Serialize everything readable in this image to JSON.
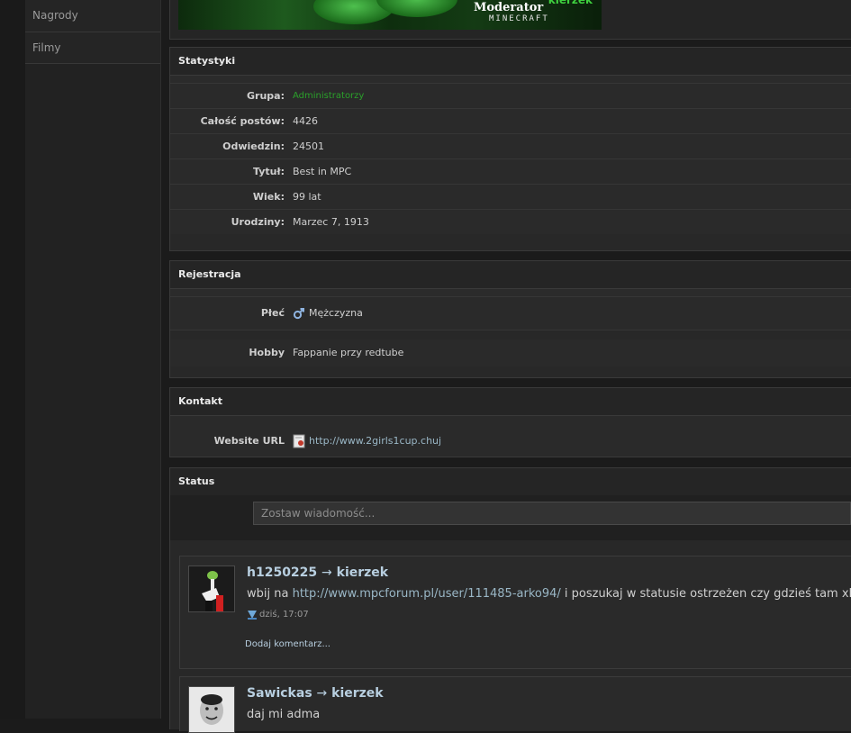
{
  "sidebar": {
    "items": [
      {
        "label": "Nagrody"
      },
      {
        "label": "Filmy"
      }
    ]
  },
  "banner": {
    "brand_text": "kierzek",
    "title": "Moderator",
    "subtitle": "MINECRAFT"
  },
  "statystyki": {
    "title": "Statystyki",
    "rows": [
      {
        "label": "Grupa:",
        "value": "Administratorzy"
      },
      {
        "label": "Całość postów:",
        "value": "4426"
      },
      {
        "label": "Odwiedzin:",
        "value": "24501"
      },
      {
        "label": "Tytuł:",
        "value": "Best in MPC"
      },
      {
        "label": "Wiek:",
        "value": "99 lat"
      },
      {
        "label": "Urodziny:",
        "value": "Marzec 7, 1913"
      }
    ]
  },
  "rejestracja": {
    "title": "Rejestracja",
    "rows": [
      {
        "label": "Płeć",
        "value": "Mężczyzna",
        "icon": "male-icon"
      },
      {
        "label": "Hobby",
        "value": "Fappanie przy redtube"
      }
    ]
  },
  "kontakt": {
    "title": "Kontakt",
    "rows": [
      {
        "label": "Website URL",
        "value": "http://www.2girls1cup.chuj",
        "icon": "web-page-icon"
      }
    ]
  },
  "status": {
    "title": "Status",
    "input_placeholder": "Zostaw wiadomość...",
    "entries": [
      {
        "from": "h1250225",
        "arrow": "→",
        "to": "kierzek",
        "message_prefix": "wbij na ",
        "message_link": "http://www.mpcforum.pl/user/111485-arko94/",
        "message_suffix": " i poszukaj w statusie ostrzeżen czy gdzieś tam xDDD",
        "time": "dziś, 17:07",
        "comment_label": "Dodaj komentarz..."
      },
      {
        "from": "Sawickas",
        "arrow": "→",
        "to": "kierzek",
        "message_prefix": "daj mi adma"
      }
    ]
  },
  "colors": {
    "background": "#1b1b1b",
    "panel": "#282828",
    "group_green": "#2aa12a",
    "link_blue": "#9ab7c6"
  }
}
